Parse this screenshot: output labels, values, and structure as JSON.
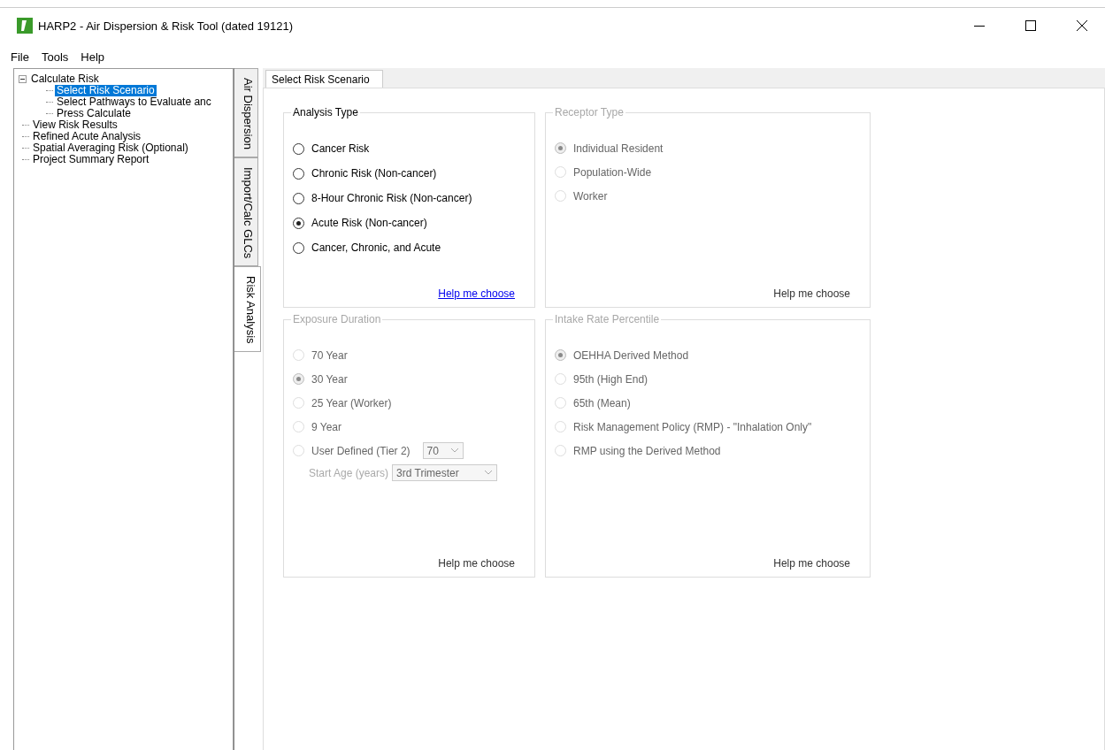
{
  "window": {
    "title": "HARP2 - Air Dispersion & Risk Tool (dated 19121)"
  },
  "menu": [
    "File",
    "Tools",
    "Help"
  ],
  "tree": [
    {
      "label": "Calculate Risk",
      "expanded": true,
      "selected": false,
      "children": [
        {
          "label": "Select Risk Scenario",
          "selected": true
        },
        {
          "label": "Select Pathways to Evaluate anc",
          "selected": false
        },
        {
          "label": "Press Calculate",
          "selected": false
        }
      ]
    },
    {
      "label": "View Risk Results",
      "selected": false
    },
    {
      "label": "Refined Acute Analysis",
      "selected": false
    },
    {
      "label": "Spatial Averaging Risk (Optional)",
      "selected": false
    },
    {
      "label": "Project Summary Report",
      "selected": false
    }
  ],
  "side_tabs": [
    {
      "label": "Air Dispersion",
      "selected": false
    },
    {
      "label": "Import/Calc GLCs",
      "selected": false
    },
    {
      "label": "Risk Analysis",
      "selected": true
    }
  ],
  "tabs": [
    {
      "label": "Select Risk Scenario",
      "selected": true
    }
  ],
  "groups": [
    {
      "title": "Analysis Type",
      "disabled": false,
      "help": "Help me choose",
      "options": [
        {
          "label": "Cancer Risk",
          "selected": false
        },
        {
          "label": "Chronic Risk (Non-cancer)",
          "selected": false
        },
        {
          "label": "8-Hour Chronic Risk (Non-cancer)",
          "selected": false
        },
        {
          "label": "Acute Risk (Non-cancer)",
          "selected": true
        },
        {
          "label": "Cancer, Chronic, and Acute",
          "selected": false
        }
      ]
    },
    {
      "title": "Receptor Type",
      "disabled": true,
      "help": "Help me choose",
      "options": [
        {
          "label": "Individual Resident",
          "selected": true
        },
        {
          "label": "Population-Wide",
          "selected": false
        },
        {
          "label": "Worker",
          "selected": false
        }
      ]
    },
    {
      "title": "Exposure Duration",
      "disabled": true,
      "help": "Help me choose",
      "options": [
        {
          "label": "70 Year",
          "selected": false
        },
        {
          "label": "30 Year",
          "selected": true
        },
        {
          "label": "25 Year (Worker)",
          "selected": false
        },
        {
          "label": "9 Year",
          "selected": false
        },
        {
          "label": "User Defined (Tier 2)",
          "selected": false,
          "dropdown": "70"
        }
      ],
      "start_age": {
        "label": "Start Age (years)",
        "value": "3rd Trimester"
      }
    },
    {
      "title": "Intake Rate Percentile",
      "disabled": true,
      "help": "Help me choose",
      "options": [
        {
          "label": "OEHHA Derived Method",
          "selected": true
        },
        {
          "label": "95th (High End)",
          "selected": false
        },
        {
          "label": "65th (Mean)",
          "selected": false
        },
        {
          "label": "Risk Management Policy (RMP) - \"Inhalation Only\"",
          "selected": false
        },
        {
          "label": "RMP using the Derived Method",
          "selected": false
        }
      ]
    }
  ]
}
